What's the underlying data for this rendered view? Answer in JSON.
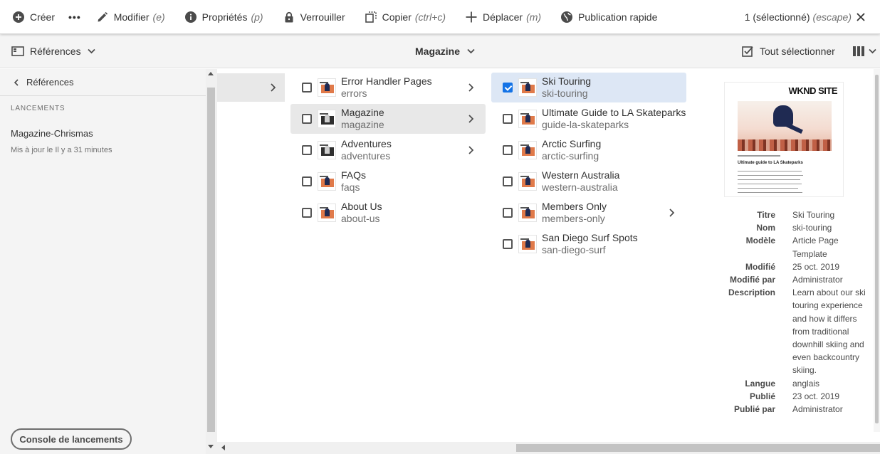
{
  "actionbar": {
    "create": "Créer",
    "more": "•••",
    "edit": "Modifier",
    "edit_key": "(e)",
    "properties": "Propriétés",
    "properties_key": "(p)",
    "lock": "Verrouiller",
    "copy": "Copier",
    "copy_key": "(ctrl+c)",
    "move": "Déplacer",
    "move_key": "(m)",
    "quick_publish": "Publication rapide",
    "selection": "1 (sélectionné)",
    "selection_key": "(escape)"
  },
  "secbar": {
    "rail_toggle": "Références",
    "breadcrumb": "Magazine",
    "select_all": "Tout sélectionner"
  },
  "rail": {
    "back_label": "Références",
    "section": "LANCEMENTS",
    "item_title": "Magazine-Chrismas",
    "item_sub": "Mis à jour le Il y a 31 minutes",
    "console_button": "Console de lancements"
  },
  "column1": [
    {
      "title": "Error Handler Pages",
      "name": "errors",
      "children": true
    },
    {
      "title": "Magazine",
      "name": "magazine",
      "children": true
    },
    {
      "title": "Adventures",
      "name": "adventures",
      "children": true
    },
    {
      "title": "FAQs",
      "name": "faqs",
      "children": false
    },
    {
      "title": "About Us",
      "name": "about-us",
      "children": false
    }
  ],
  "column2": [
    {
      "title": "Ski Touring",
      "name": "ski-touring",
      "children": false
    },
    {
      "title": "Ultimate Guide to LA Skateparks",
      "name": "guide-la-skateparks",
      "children": false
    },
    {
      "title": "Arctic Surfing",
      "name": "arctic-surfing",
      "children": false
    },
    {
      "title": "Western Australia",
      "name": "western-australia",
      "children": false
    },
    {
      "title": "Members Only",
      "name": "members-only",
      "children": true
    },
    {
      "title": "San Diego Surf Spots",
      "name": "san-diego-surf",
      "children": false
    }
  ],
  "preview": {
    "logo": "WKND SITE",
    "heading": "Ultimate guide to LA Skateparks"
  },
  "properties": {
    "titre_k": "Titre",
    "titre_v": "Ski Touring",
    "nom_k": "Nom",
    "nom_v": "ski-touring",
    "modele_k": "Modèle",
    "modele_v": "Article Page Template",
    "modifie_k": "Modifié",
    "modifie_v": "25 oct. 2019",
    "modifie_par_k": "Modifié par",
    "modifie_par_v": "Administrator",
    "description_k": "Description",
    "description_v": "Learn about our ski touring experience and how it differs from traditional downhill skiing and even backcountry skiing.",
    "langue_k": "Langue",
    "langue_v": "anglais",
    "publie_k": "Publié",
    "publie_v": "23 oct. 2019",
    "publie_par_k": "Publié par",
    "publie_par_v": "Administrator"
  }
}
